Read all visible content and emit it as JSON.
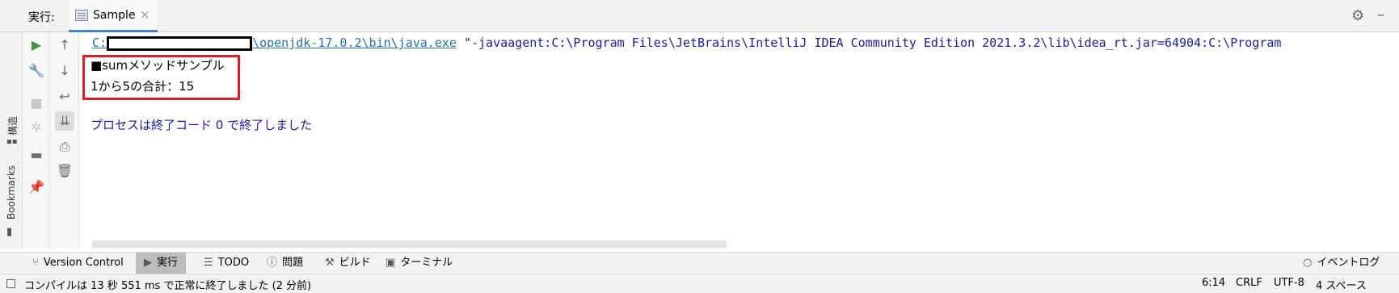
{
  "header": {
    "run_label": "実行:",
    "tab_label": "Sample",
    "tab_close": "×"
  },
  "sidebar": {
    "structure_label": "構造",
    "bookmarks_label": "Bookmarks"
  },
  "console": {
    "path_prefix": "C:",
    "path_suffix": "\\openjdk-17.0.2\\bin\\java.exe",
    "command_rest": " \"-javaagent:C:\\Program Files\\JetBrains\\IntelliJ IDEA Community Edition 2021.3.2\\lib\\idea_rt.jar=64904:C:\\Program",
    "output_line1": "■sumメソッドサンプル",
    "output_line2": "1から5の合計：15",
    "exit_message": "プロセスは終了コード 0 で終了しました"
  },
  "bottom_tabs": [
    {
      "label": "Version Control",
      "icon": "branch-icon"
    },
    {
      "label": "実行",
      "icon": "run-icon"
    },
    {
      "label": "TODO",
      "icon": "list-icon"
    },
    {
      "label": "問題",
      "icon": "problems-icon"
    },
    {
      "label": "ビルド",
      "icon": "hammer-icon"
    },
    {
      "label": "ターミナル",
      "icon": "terminal-icon"
    }
  ],
  "event_log": "イベントログ",
  "status": {
    "message": "コンパイルは 13 秒 551 ms で正常に終了しました (2 分前)",
    "position": "6:14",
    "line_ending": "CRLF",
    "encoding": "UTF-8",
    "indent": "4 スペース"
  },
  "colors": {
    "highlight_box": "#e02020",
    "link": "#2470b3",
    "console_text": "#1a1aa6",
    "run_green": "#3c9a3c",
    "active_tab_underline": "#4083c9"
  }
}
